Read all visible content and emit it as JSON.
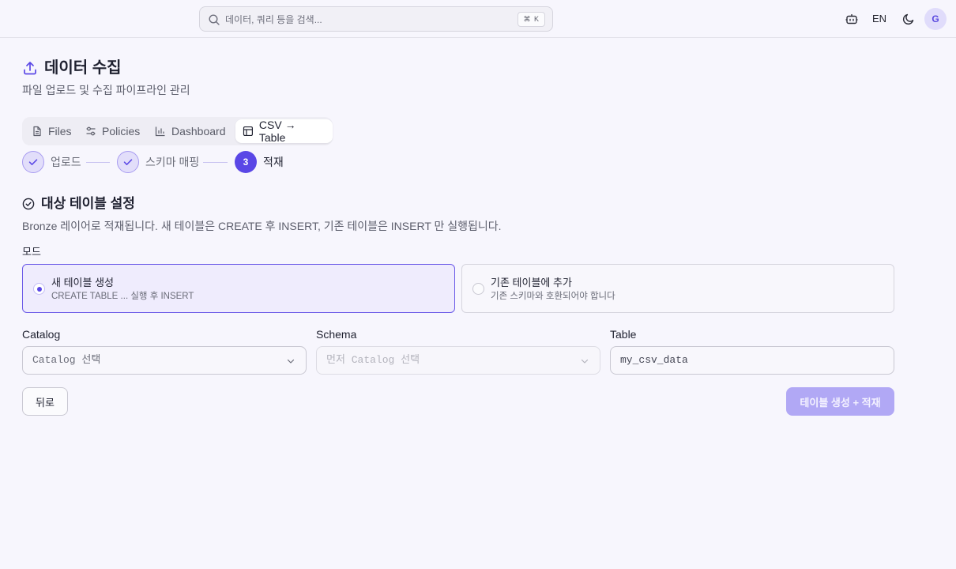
{
  "search": {
    "placeholder": "데이터, 쿼리 등을 검색...",
    "shortcut": "⌘ K"
  },
  "header": {
    "language": "EN",
    "avatar_initial": "G"
  },
  "page": {
    "title": "데이터 수집",
    "subtitle": "파일 업로드 및 수집 파이프라인 관리"
  },
  "tabs": [
    {
      "label": "Files",
      "icon": "file-icon"
    },
    {
      "label": "Policies",
      "icon": "sliders-icon"
    },
    {
      "label": "Dashboard",
      "icon": "bar-chart-icon"
    },
    {
      "label": "CSV → Table",
      "icon": "table-icon",
      "active": true
    }
  ],
  "steps": [
    {
      "label": "업로드",
      "status": "done"
    },
    {
      "label": "스키마 매핑",
      "status": "done"
    },
    {
      "label": "적재",
      "number": "3",
      "status": "current"
    }
  ],
  "section": {
    "title": "대상 테이블 설정",
    "description": "Bronze 레이어로 적재됩니다. 새 테이블은 CREATE 후 INSERT, 기존 테이블은 INSERT 만 실행됩니다."
  },
  "mode": {
    "label": "모드",
    "options": [
      {
        "title": "새 테이블 생성",
        "subtitle": "CREATE TABLE ... 실행 후 INSERT",
        "selected": true
      },
      {
        "title": "기존 테이블에 추가",
        "subtitle": "기존 스키마와 호환되어야 합니다",
        "selected": false
      }
    ]
  },
  "fields": {
    "catalog": {
      "label": "Catalog",
      "value": "Catalog 선택"
    },
    "schema": {
      "label": "Schema",
      "value": "먼저 Catalog 선택"
    },
    "table": {
      "label": "Table",
      "placeholder": "my_csv_data"
    }
  },
  "buttons": {
    "back": "뒤로",
    "submit": "테이블 생성 + 적재"
  },
  "colors": {
    "accent": "#5a47e6",
    "accent_light": "#efecfd",
    "background": "#f7f6fd"
  }
}
